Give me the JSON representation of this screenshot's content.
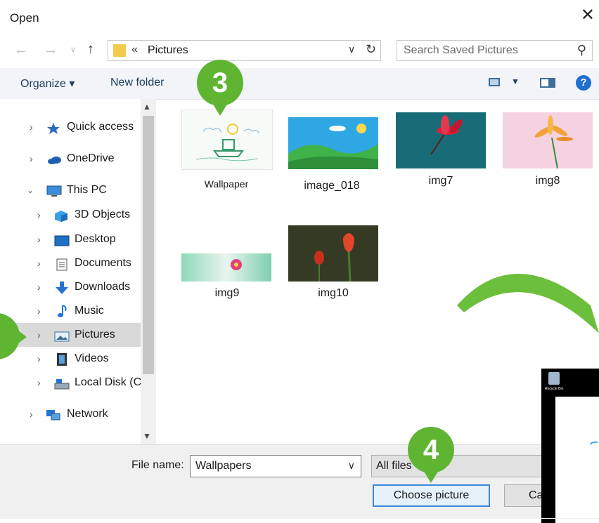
{
  "window": {
    "title": "Open"
  },
  "address": {
    "prefix": "«",
    "folder": "Pictures"
  },
  "search": {
    "placeholder": "Search Saved Pictures"
  },
  "toolbar": {
    "organize": "Organize ▾",
    "new_folder": "New folder"
  },
  "nav": {
    "items": [
      {
        "label": "Quick access",
        "icon": "star-icon"
      },
      {
        "label": "OneDrive",
        "icon": "cloud-icon"
      },
      {
        "label": "This PC",
        "icon": "monitor-icon"
      },
      {
        "label": "3D Objects",
        "icon": "cube-icon"
      },
      {
        "label": "Desktop",
        "icon": "desktop-icon"
      },
      {
        "label": "Documents",
        "icon": "document-icon"
      },
      {
        "label": "Downloads",
        "icon": "download-icon"
      },
      {
        "label": "Music",
        "icon": "music-icon"
      },
      {
        "label": "Pictures",
        "icon": "pictures-icon"
      },
      {
        "label": "Videos",
        "icon": "video-icon"
      },
      {
        "label": "Local Disk (C",
        "icon": "disk-icon"
      },
      {
        "label": "Network",
        "icon": "network-icon"
      }
    ],
    "selected": "Pictures"
  },
  "files": [
    {
      "name": "Wallpaper"
    },
    {
      "name": "image_018"
    },
    {
      "name": "img7"
    },
    {
      "name": "img8"
    },
    {
      "name": "img9"
    },
    {
      "name": "img10"
    }
  ],
  "bottom": {
    "file_name_label": "File name:",
    "file_name_value": "Wallpapers",
    "file_type": "All files",
    "choose_button": "Choose picture",
    "cancel_button": "Ca"
  },
  "callouts": {
    "step3": "3",
    "step4": "4"
  },
  "desktop_preview": {
    "recycle_label": "Recycle Bin"
  },
  "colors": {
    "accent_green": "#5fb532",
    "selection": "#d9d9d9",
    "button_border": "#3b86d8"
  }
}
